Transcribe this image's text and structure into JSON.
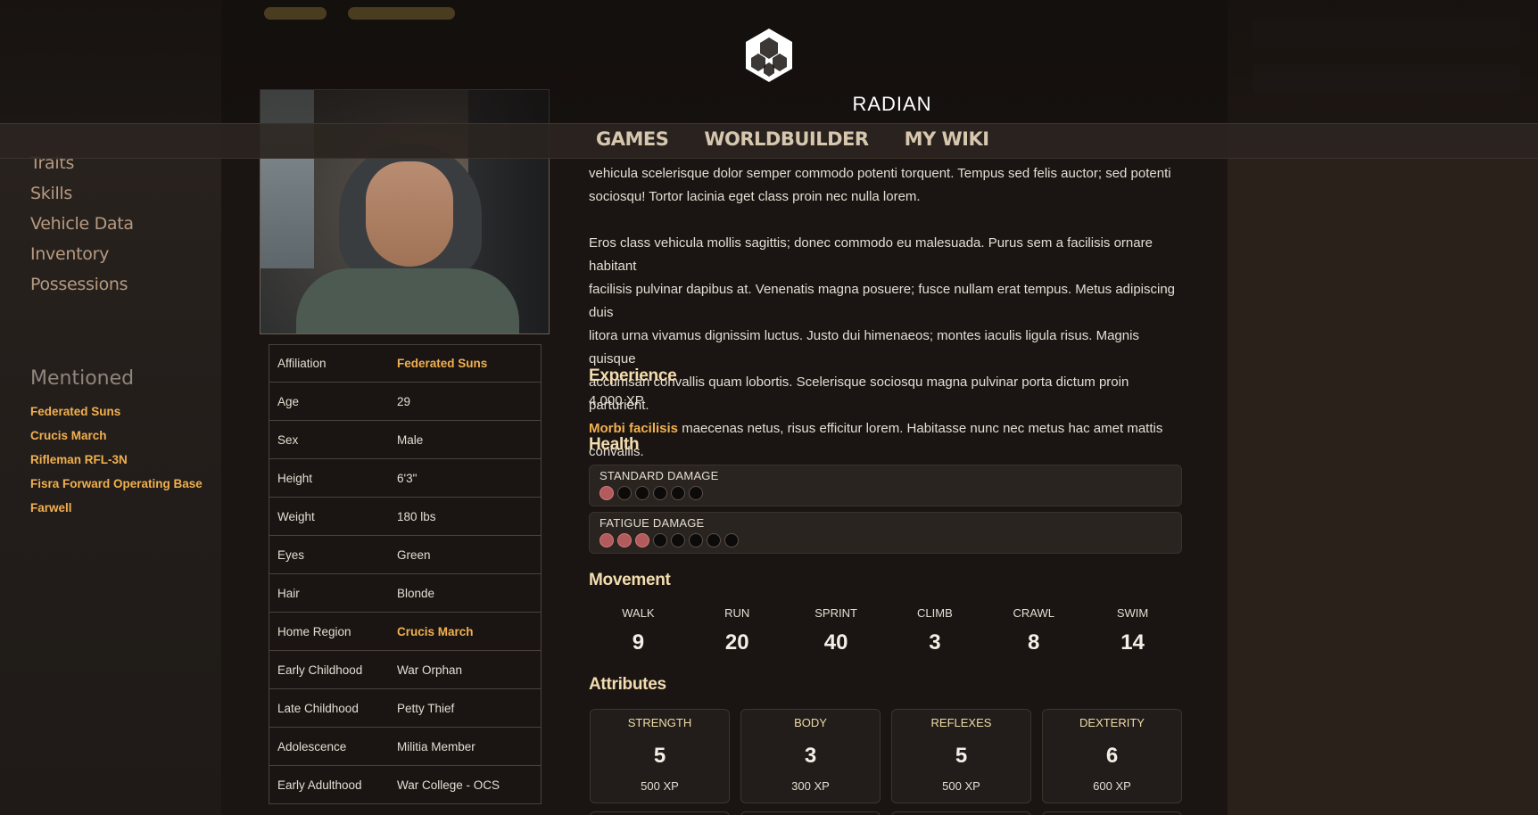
{
  "brand": {
    "name": "RADIAN"
  },
  "top_nav": [
    {
      "label": "GAMES"
    },
    {
      "label": "WORLDBUILDER"
    },
    {
      "label": "MY WIKI"
    }
  ],
  "sidebar": {
    "items": [
      {
        "label": "Traits"
      },
      {
        "label": "Skills"
      },
      {
        "label": "Vehicle Data"
      },
      {
        "label": "Inventory"
      },
      {
        "label": "Possessions"
      }
    ],
    "mentioned_title": "Mentioned",
    "mentioned": [
      {
        "label": "Federated Suns"
      },
      {
        "label": "Crucis March"
      },
      {
        "label": "Rifleman RFL-3N"
      },
      {
        "label": "Fisra Forward Operating Base"
      },
      {
        "label": "Farwell"
      }
    ]
  },
  "info": [
    {
      "key": "Affiliation",
      "value": "Federated Suns",
      "link": true
    },
    {
      "key": "Age",
      "value": "29"
    },
    {
      "key": "Sex",
      "value": "Male"
    },
    {
      "key": "Height",
      "value": "6'3\""
    },
    {
      "key": "Weight",
      "value": "180 lbs"
    },
    {
      "key": "Eyes",
      "value": "Green"
    },
    {
      "key": "Hair",
      "value": "Blonde"
    },
    {
      "key": "Home Region",
      "value": "Crucis March",
      "link": true
    },
    {
      "key": "Early Childhood",
      "value": "War Orphan"
    },
    {
      "key": "Late Childhood",
      "value": "Petty Thief"
    },
    {
      "key": "Adolescence",
      "value": "Militia Member"
    },
    {
      "key": "Early Adulthood",
      "value": "War College - OCS"
    }
  ],
  "description": {
    "para1_lines": [
      "vehicula scelerisque dolor semper commodo potenti torquent. Tempus sed felis auctor; sed potenti",
      "sociosqu! Tortor lacinia eget class proin nec nulla lorem."
    ],
    "para2_lines": [
      "Eros class vehicula mollis sagittis; donec commodo eu malesuada. Purus sem a facilisis ornare habitant",
      "facilisis pulvinar dapibus at. Venenatis magna posuere; fusce nullam erat tempus. Metus adipiscing duis",
      "litora urna vivamus dignissim luctus. Justo dui himenaeos; montes iaculis ligula risus. Magnis quisque",
      "accumsan convallis quam lobortis. Scelerisque sociosqu magna pulvinar porta dictum proin parturient."
    ],
    "para2_link": "Morbi facilisis",
    "para2_tail": " maecenas netus, risus efficitur lorem. Habitasse nunc nec metus hac amet mattis convallis."
  },
  "experience": {
    "title": "Experience",
    "value": "4,000 XP"
  },
  "health": {
    "title": "Health",
    "tracks": [
      {
        "label": "STANDARD DAMAGE",
        "total": 6,
        "filled": 1
      },
      {
        "label": "FATIGUE DAMAGE",
        "total": 8,
        "filled": 3
      }
    ]
  },
  "movement": {
    "title": "Movement",
    "stats": [
      {
        "label": "WALK",
        "value": "9"
      },
      {
        "label": "RUN",
        "value": "20"
      },
      {
        "label": "SPRINT",
        "value": "40"
      },
      {
        "label": "CLIMB",
        "value": "3"
      },
      {
        "label": "CRAWL",
        "value": "8"
      },
      {
        "label": "SWIM",
        "value": "14"
      }
    ]
  },
  "attributes": {
    "title": "Attributes",
    "stats": [
      {
        "label": "STRENGTH",
        "value": "5",
        "xp": "500 XP"
      },
      {
        "label": "BODY",
        "value": "3",
        "xp": "300 XP"
      },
      {
        "label": "REFLEXES",
        "value": "5",
        "xp": "500 XP"
      },
      {
        "label": "DEXTERITY",
        "value": "6",
        "xp": "600 XP"
      }
    ]
  },
  "colors": {
    "accent": "#f2b04f",
    "heading": "#f3ddb0",
    "damage": "#b35a5c"
  }
}
